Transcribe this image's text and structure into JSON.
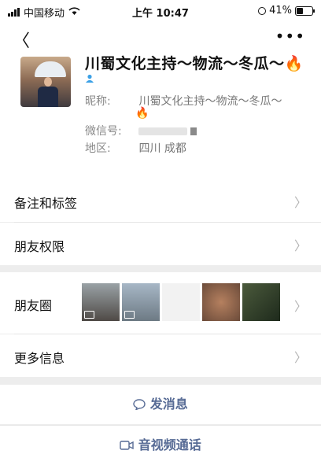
{
  "status_bar": {
    "carrier": "中国移动",
    "time": "上午 10:47",
    "battery": "41%"
  },
  "profile": {
    "name": "川蜀文化主持～物流～冬瓜～🔥",
    "nickname_label": "昵称:",
    "nickname_value": "川蜀文化主持～物流～冬瓜～",
    "nickname_emoji": "🔥",
    "wechat_label": "微信号:",
    "region_label": "地区:",
    "region_value": "四川 成都"
  },
  "menu": {
    "notes_tags": "备注和标签",
    "permissions": "朋友权限",
    "moments": "朋友圈",
    "more_info": "更多信息"
  },
  "actions": {
    "message": "发消息",
    "call": "音视频通话"
  },
  "colors": {
    "link": "#576b95",
    "gender_male": "#3aa0e6"
  }
}
